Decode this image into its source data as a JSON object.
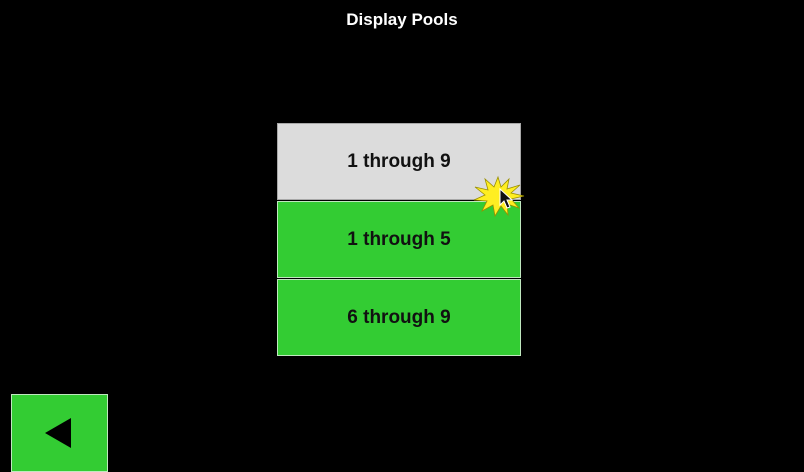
{
  "screen": {
    "title": "Display Pools"
  },
  "menu": {
    "options": [
      {
        "label": "1 through 9",
        "state": "selected"
      },
      {
        "label": "1 through 5",
        "state": "normal"
      },
      {
        "label": "6 through 9",
        "state": "normal"
      }
    ]
  },
  "navigation": {
    "back_icon": "left-triangle-icon"
  },
  "colors": {
    "background": "#000000",
    "button_green": "#33cc33",
    "button_selected": "#dcdcdc",
    "title_text": "#ffffff",
    "click_burst": "#ffee22"
  }
}
